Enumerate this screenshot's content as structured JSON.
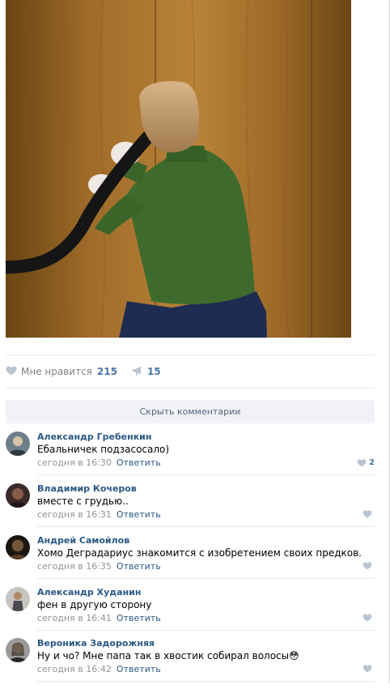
{
  "post": {
    "likes": {
      "label": "Мне нравится",
      "count": "215"
    },
    "shares": {
      "count": "15"
    },
    "hide_comments_label": "Скрыть комментарии"
  },
  "comments": [
    {
      "author": "Александр Гребенкин",
      "text": "Ебальничек подзасосало)",
      "time": "сегодня в 16:30",
      "reply": "Ответить",
      "likes": "2"
    },
    {
      "author": "Владимир Кочеров",
      "text": "вместе с грудью..",
      "time": "сегодня в 16:31",
      "reply": "Ответить",
      "likes": ""
    },
    {
      "author": "Андрей Самойлов",
      "text": "Хомо Деградариус знакомится с изобретением своих предков.",
      "time": "сегодня в 16:35",
      "reply": "Ответить",
      "likes": ""
    },
    {
      "author": "Александр Худанин",
      "text": "фен в другую сторону",
      "time": "сегодня в 16:41",
      "reply": "Ответить",
      "likes": ""
    },
    {
      "author": "Вероника Задорожняя",
      "text": "Ну и чо? Мне папа так в хвостик собирал волосы😳",
      "time": "сегодня в 16:42",
      "reply": "Ответить",
      "likes": ""
    }
  ],
  "colors": {
    "link": "#2a5885",
    "accent": "#4a76a8",
    "muted": "#939393",
    "button_bg": "#f0f2f5"
  },
  "icons": [
    "heart-icon",
    "megaphone-icon"
  ]
}
